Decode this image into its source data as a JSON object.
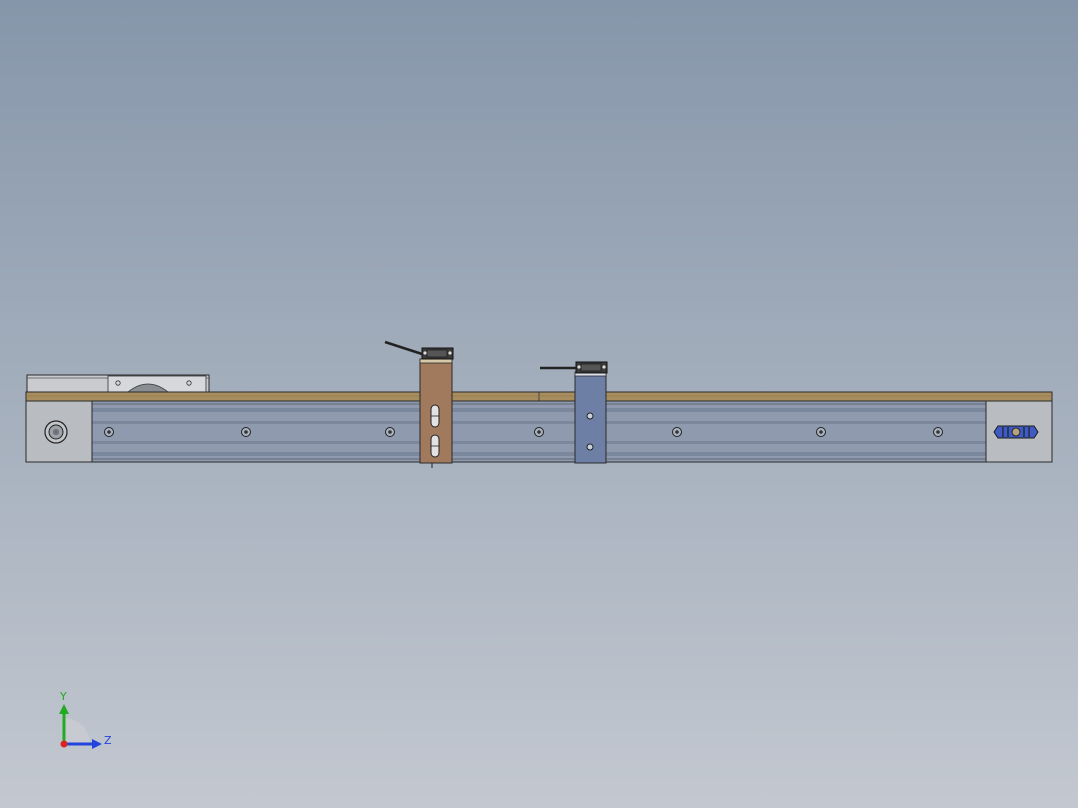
{
  "viewport": {
    "background_top": "#8696aa",
    "background_bottom": "#c3c8d0"
  },
  "colors": {
    "rail_body": "#8f9aae",
    "rail_stripe": "#7b879c",
    "top_plate": "#a88d5e",
    "end_cap": "#b9bcc0",
    "carriage_brown": "#a1795c",
    "carriage_blue": "#6e7fa6",
    "motor_box": "#c9cbcf",
    "outline": "#2a2a2a",
    "axis_y": "#22aa22",
    "axis_z": "#2244dd",
    "axis_x": "#dd2222"
  },
  "triad": {
    "y_label": "Y",
    "z_label": "Z"
  }
}
